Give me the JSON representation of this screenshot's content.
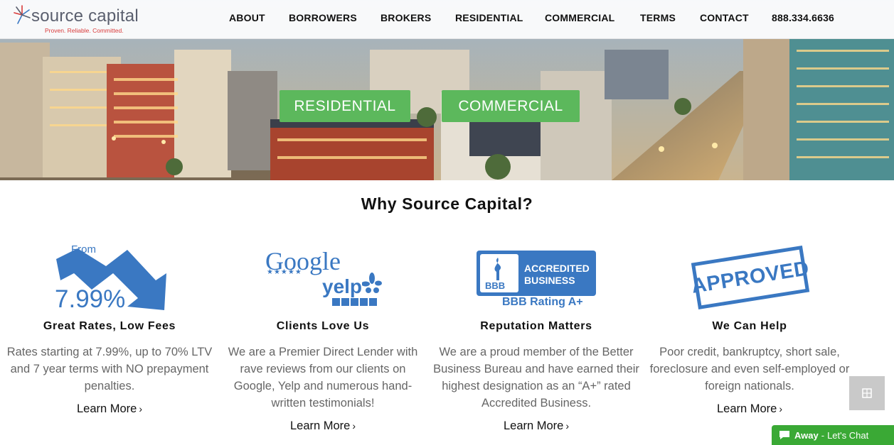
{
  "brand": {
    "name": "source capital",
    "tagline": "Proven. Reliable. Committed."
  },
  "nav": {
    "items": [
      "ABOUT",
      "BORROWERS",
      "BROKERS",
      "RESIDENTIAL",
      "COMMERCIAL",
      "TERMS",
      "CONTACT"
    ],
    "phone": "888.334.6636"
  },
  "hero": {
    "residential_button": "RESIDENTIAL",
    "commercial_button": "COMMERCIAL"
  },
  "why": {
    "title": "Why Source Capital?",
    "features": [
      {
        "title": "Great Rates, Low Fees",
        "text": "Rates starting at 7.99%, up to 70% LTV and 7 year terms with NO prepayment penalties.",
        "link": "Learn More",
        "art_from": "From",
        "art_rate": "7.99%"
      },
      {
        "title": "Clients Love Us",
        "text": "We are a Premier Direct Lender with rave reviews from our clients on Google, Yelp and numerous hand-written testimonials!",
        "link": "Learn More",
        "art_google": "Google",
        "art_yelp": "yelp"
      },
      {
        "title": "Reputation Matters",
        "text": "We are a proud member of the Better Business Bureau and have earned their highest designation as an “A+” rated Accredited Business.",
        "link": "Learn More",
        "art_bbb_line1": "ACCREDITED",
        "art_bbb_line2": "BUSINESS",
        "art_bbb_logo": "BBB",
        "art_bbb_rating": "BBB Rating A+"
      },
      {
        "title": "We Can Help",
        "text": "Poor credit, bankruptcy,  short sale, foreclosure and even self-employed or foreign nationals.",
        "link": "Learn More",
        "art_stamp": "APPROVED"
      }
    ]
  },
  "chat": {
    "status": "Away",
    "separator": "-",
    "cta": "Let's Chat"
  },
  "colors": {
    "accent_green": "#5cb85c",
    "brand_blue": "#3a78c2",
    "brand_red": "#d93a3a",
    "chat_green": "#3aa935"
  }
}
